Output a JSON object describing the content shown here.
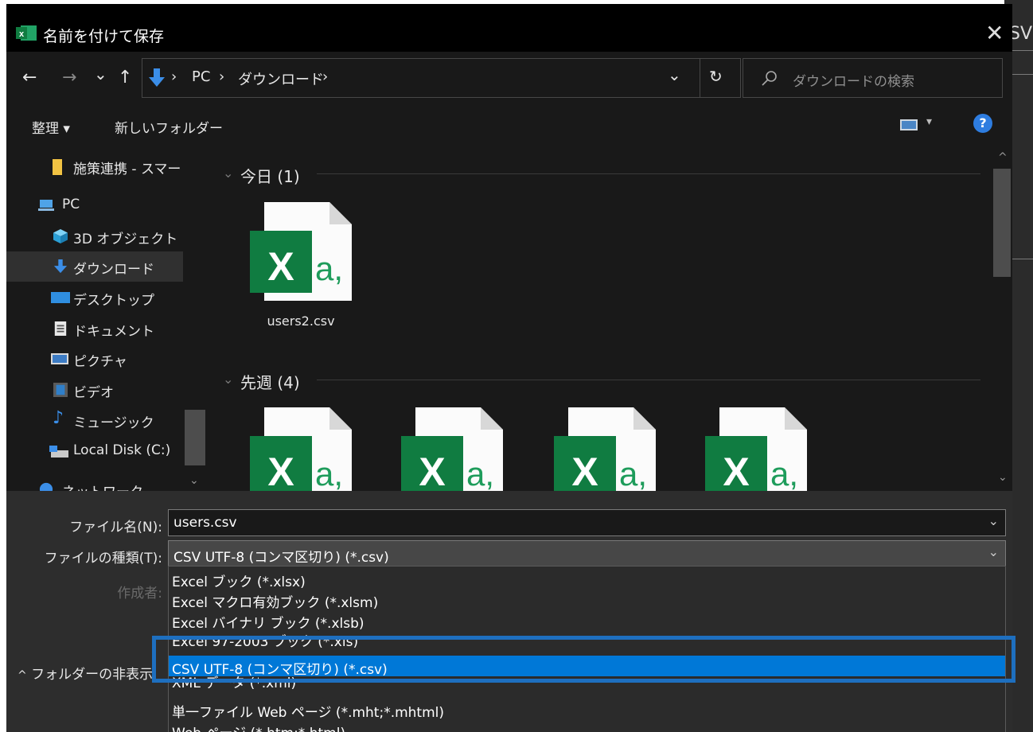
{
  "background": {
    "partial_text": "SV"
  },
  "titlebar": {
    "title": "名前を付けて保存",
    "close": "✕"
  },
  "nav": {
    "back": "←",
    "forward": "→",
    "recent": "⌄",
    "up": "↑",
    "path": [
      "PC",
      "ダウンロード"
    ],
    "separator": "›",
    "refresh": "↻",
    "search_placeholder": "ダウンロードの検索"
  },
  "toolbar": {
    "organize": "整理 ▾",
    "new_folder": "新しいフォルダー",
    "help": "?"
  },
  "sidebar": {
    "items": [
      {
        "label": "施策連携 - スマー",
        "icon": "folder-icon"
      },
      {
        "label": "PC",
        "icon": "pc-icon"
      },
      {
        "label": "3D オブジェクト",
        "icon": "cube-icon"
      },
      {
        "label": "ダウンロード",
        "icon": "download-icon",
        "selected": true
      },
      {
        "label": "デスクトップ",
        "icon": "desktop-icon"
      },
      {
        "label": "ドキュメント",
        "icon": "document-icon"
      },
      {
        "label": "ピクチャ",
        "icon": "picture-icon"
      },
      {
        "label": "ビデオ",
        "icon": "video-icon"
      },
      {
        "label": "ミュージック",
        "icon": "music-icon"
      },
      {
        "label": "Local Disk (C:)",
        "icon": "disk-icon"
      },
      {
        "label": "ネットワーク",
        "icon": "network-icon"
      }
    ]
  },
  "groups": [
    {
      "header": "今日 (1)",
      "files": [
        "users2.csv"
      ]
    },
    {
      "header": "先週 (4)",
      "files": [
        "",
        "",
        "",
        ""
      ]
    }
  ],
  "file_icon_text": {
    "x": "X",
    "a": "a,"
  },
  "form": {
    "filename_label": "ファイル名(N):",
    "filename_value": "users.csv",
    "filetype_label": "ファイルの種類(T):",
    "filetype_value": "CSV UTF-8 (コンマ区切り) (*.csv)",
    "author_label": "作成者:",
    "hide_folders": "フォルダーの非表示"
  },
  "filetype_options": [
    "Excel ブック (*.xlsx)",
    "Excel マクロ有効ブック (*.xlsm)",
    "Excel バイナリ ブック (*.xlsb)",
    "Excel 97-2003 ブック (*.xls)",
    "CSV UTF-8 (コンマ区切り) (*.csv)",
    "XML データ (*.xml)",
    "単一ファイル Web ページ (*.mht;*.mhtml)",
    "Web ページ (*.htm;*.html)"
  ],
  "selected_option_index": 4,
  "colors": {
    "accent": "#0078d7",
    "highlight_box": "#1e6fbf",
    "excel_green": "#107c41"
  }
}
